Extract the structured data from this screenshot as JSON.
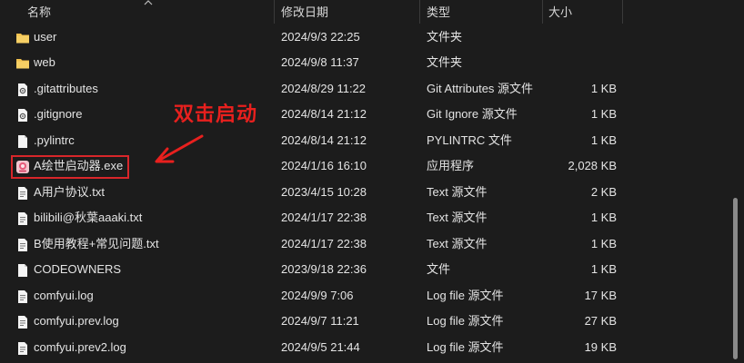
{
  "columns": {
    "name": "名称",
    "date": "修改日期",
    "type": "类型",
    "size": "大小"
  },
  "files": [
    {
      "name": "user",
      "date": "2024/9/3 22:25",
      "type": "文件夹",
      "size": "",
      "icon": "folder-icon"
    },
    {
      "name": "web",
      "date": "2024/9/8 11:37",
      "type": "文件夹",
      "size": "",
      "icon": "folder-icon"
    },
    {
      "name": ".gitattributes",
      "date": "2024/8/29 11:22",
      "type": "Git Attributes 源文件",
      "size": "1 KB",
      "icon": "gear-file-icon"
    },
    {
      "name": ".gitignore",
      "date": "2024/8/14 21:12",
      "type": "Git Ignore 源文件",
      "size": "1 KB",
      "icon": "gear-file-icon"
    },
    {
      "name": ".pylintrc",
      "date": "2024/8/14 21:12",
      "type": "PYLINTRC 文件",
      "size": "1 KB",
      "icon": "blank-file-icon"
    },
    {
      "name": "A绘世启动器.exe",
      "date": "2024/1/16 16:10",
      "type": "应用程序",
      "size": "2,028 KB",
      "icon": "app-icon"
    },
    {
      "name": "A用户协议.txt",
      "date": "2023/4/15 10:28",
      "type": "Text 源文件",
      "size": "2 KB",
      "icon": "text-file-icon"
    },
    {
      "name": "bilibili@秋葉aaaki.txt",
      "date": "2024/1/17 22:38",
      "type": "Text 源文件",
      "size": "1 KB",
      "icon": "text-file-icon"
    },
    {
      "name": "B使用教程+常见问题.txt",
      "date": "2024/1/17 22:38",
      "type": "Text 源文件",
      "size": "1 KB",
      "icon": "text-file-icon"
    },
    {
      "name": "CODEOWNERS",
      "date": "2023/9/18 22:36",
      "type": "文件",
      "size": "1 KB",
      "icon": "blank-file-icon"
    },
    {
      "name": "comfyui.log",
      "date": "2024/9/9 7:06",
      "type": "Log file 源文件",
      "size": "17 KB",
      "icon": "text-file-icon"
    },
    {
      "name": "comfyui.prev.log",
      "date": "2024/9/7 11:21",
      "type": "Log file 源文件",
      "size": "27 KB",
      "icon": "text-file-icon"
    },
    {
      "name": "comfyui.prev2.log",
      "date": "2024/9/5 21:44",
      "type": "Log file 源文件",
      "size": "19 KB",
      "icon": "text-file-icon"
    }
  ],
  "annotation": {
    "text": "双击启动",
    "color": "#e8201e"
  },
  "colors": {
    "background": "#1c1c1c",
    "folder": "#f2c14e",
    "highlight": "#d8262a"
  }
}
